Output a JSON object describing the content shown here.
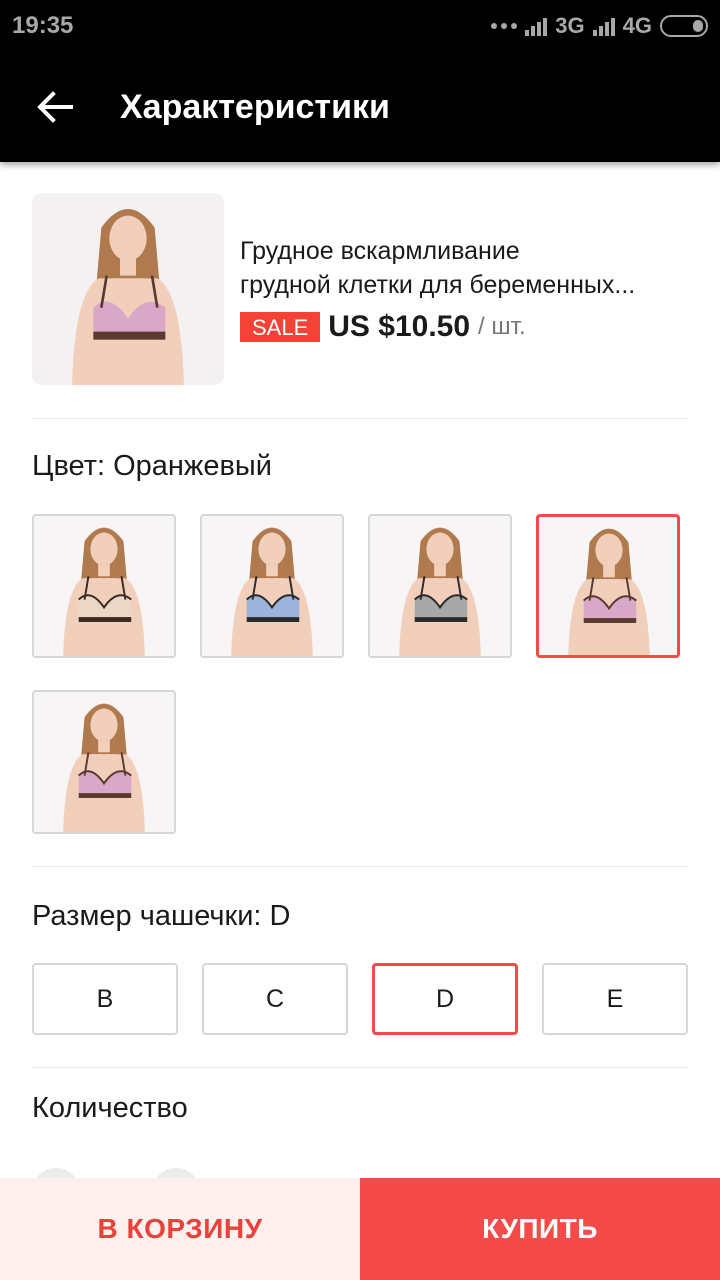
{
  "status_bar": {
    "time": "19:35",
    "network_1": "3G",
    "network_2": "4G"
  },
  "app_bar": {
    "title": "Характеристики",
    "back_icon": "arrow-left-icon"
  },
  "product": {
    "title_line1": "Грудное вскармливание",
    "title_line2": "грудной клетки для беременных...",
    "sale_badge": "SALE",
    "price": "US $10.50",
    "unit": "/ шт."
  },
  "color": {
    "label": "Цвет: Оранжевый",
    "options": [
      {
        "bra_color": "#ecd7c7",
        "trim": "#3a2a22",
        "selected": false
      },
      {
        "bra_color": "#9cb3dc",
        "trim": "#2a2a2a",
        "selected": false
      },
      {
        "bra_color": "#a8a8a8",
        "trim": "#2a2a2a",
        "selected": false
      },
      {
        "bra_color": "#d9a8c8",
        "trim": "#5a3a30",
        "selected": true
      },
      {
        "bra_color": "#d9a8c8",
        "trim": "#5a3a30",
        "selected": false
      }
    ]
  },
  "cup_size": {
    "label": "Размер чашечки: D",
    "options": [
      "B",
      "C",
      "D",
      "E"
    ],
    "selected": "D"
  },
  "quantity": {
    "label": "Количество"
  },
  "actions": {
    "cart": "В КОРЗИНУ",
    "buy": "КУПИТЬ"
  },
  "colors": {
    "accent": "#f44a4a",
    "cart_bg": "#fdf0ee"
  }
}
